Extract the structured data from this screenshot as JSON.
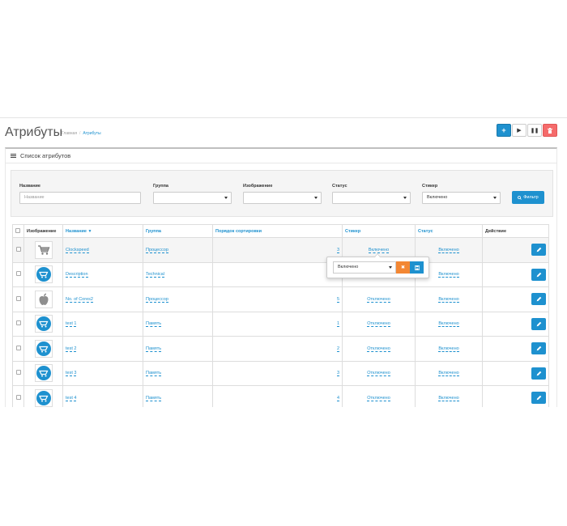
{
  "header": {
    "title": "Атрибуты",
    "breadcrumb": [
      "Главная",
      "Атрибуты"
    ],
    "buttons": [
      "add",
      "play",
      "pause",
      "delete"
    ]
  },
  "panel": {
    "title": "Список атрибутов"
  },
  "filter": {
    "name_label": "Название",
    "name_placeholder": "Название",
    "group_label": "Группа",
    "group_value": "",
    "image_label": "Изображение",
    "image_value": "",
    "status_label": "Статус",
    "status_value": "",
    "sticker_label": "Стикер",
    "sticker_value": "Включено",
    "button_label": "Фильтр"
  },
  "table": {
    "headers": {
      "image": "Изображение",
      "name": "Название",
      "group": "Группа",
      "sort_order": "Порядок сортировки",
      "sticker": "Стикер",
      "status": "Статус",
      "action": "Действие"
    },
    "rows": [
      {
        "icon": "cart-icon",
        "name": "Clockspeed",
        "group": "Процессор",
        "sort": "3",
        "sticker": "Включено",
        "status": "Включено"
      },
      {
        "icon": "cart-circle-icon",
        "name": "Description",
        "group": "Technical",
        "sort": "",
        "sticker": "",
        "status": "Включено"
      },
      {
        "icon": "apple-icon",
        "name": "No. of Cores2",
        "group": "Процессор",
        "sort": "5",
        "sticker": "Отключено",
        "status": "Включено"
      },
      {
        "icon": "cart-circle-icon",
        "name": "test 1",
        "group": "Память",
        "sort": "1",
        "sticker": "Отключено",
        "status": "Включено"
      },
      {
        "icon": "cart-circle-icon",
        "name": "test 2",
        "group": "Память",
        "sort": "2",
        "sticker": "Отключено",
        "status": "Включено"
      },
      {
        "icon": "cart-circle-icon",
        "name": "test 3",
        "group": "Память",
        "sort": "3",
        "sticker": "Отключено",
        "status": "Включено"
      },
      {
        "icon": "cart-circle-icon",
        "name": "test 4",
        "group": "Память",
        "sort": "4",
        "sticker": "Отключено",
        "status": "Включено"
      }
    ]
  },
  "popover": {
    "select_value": "Включено"
  },
  "colors": {
    "primary": "#1e91cf",
    "danger": "#f56b6b",
    "warning": "#f38733"
  }
}
